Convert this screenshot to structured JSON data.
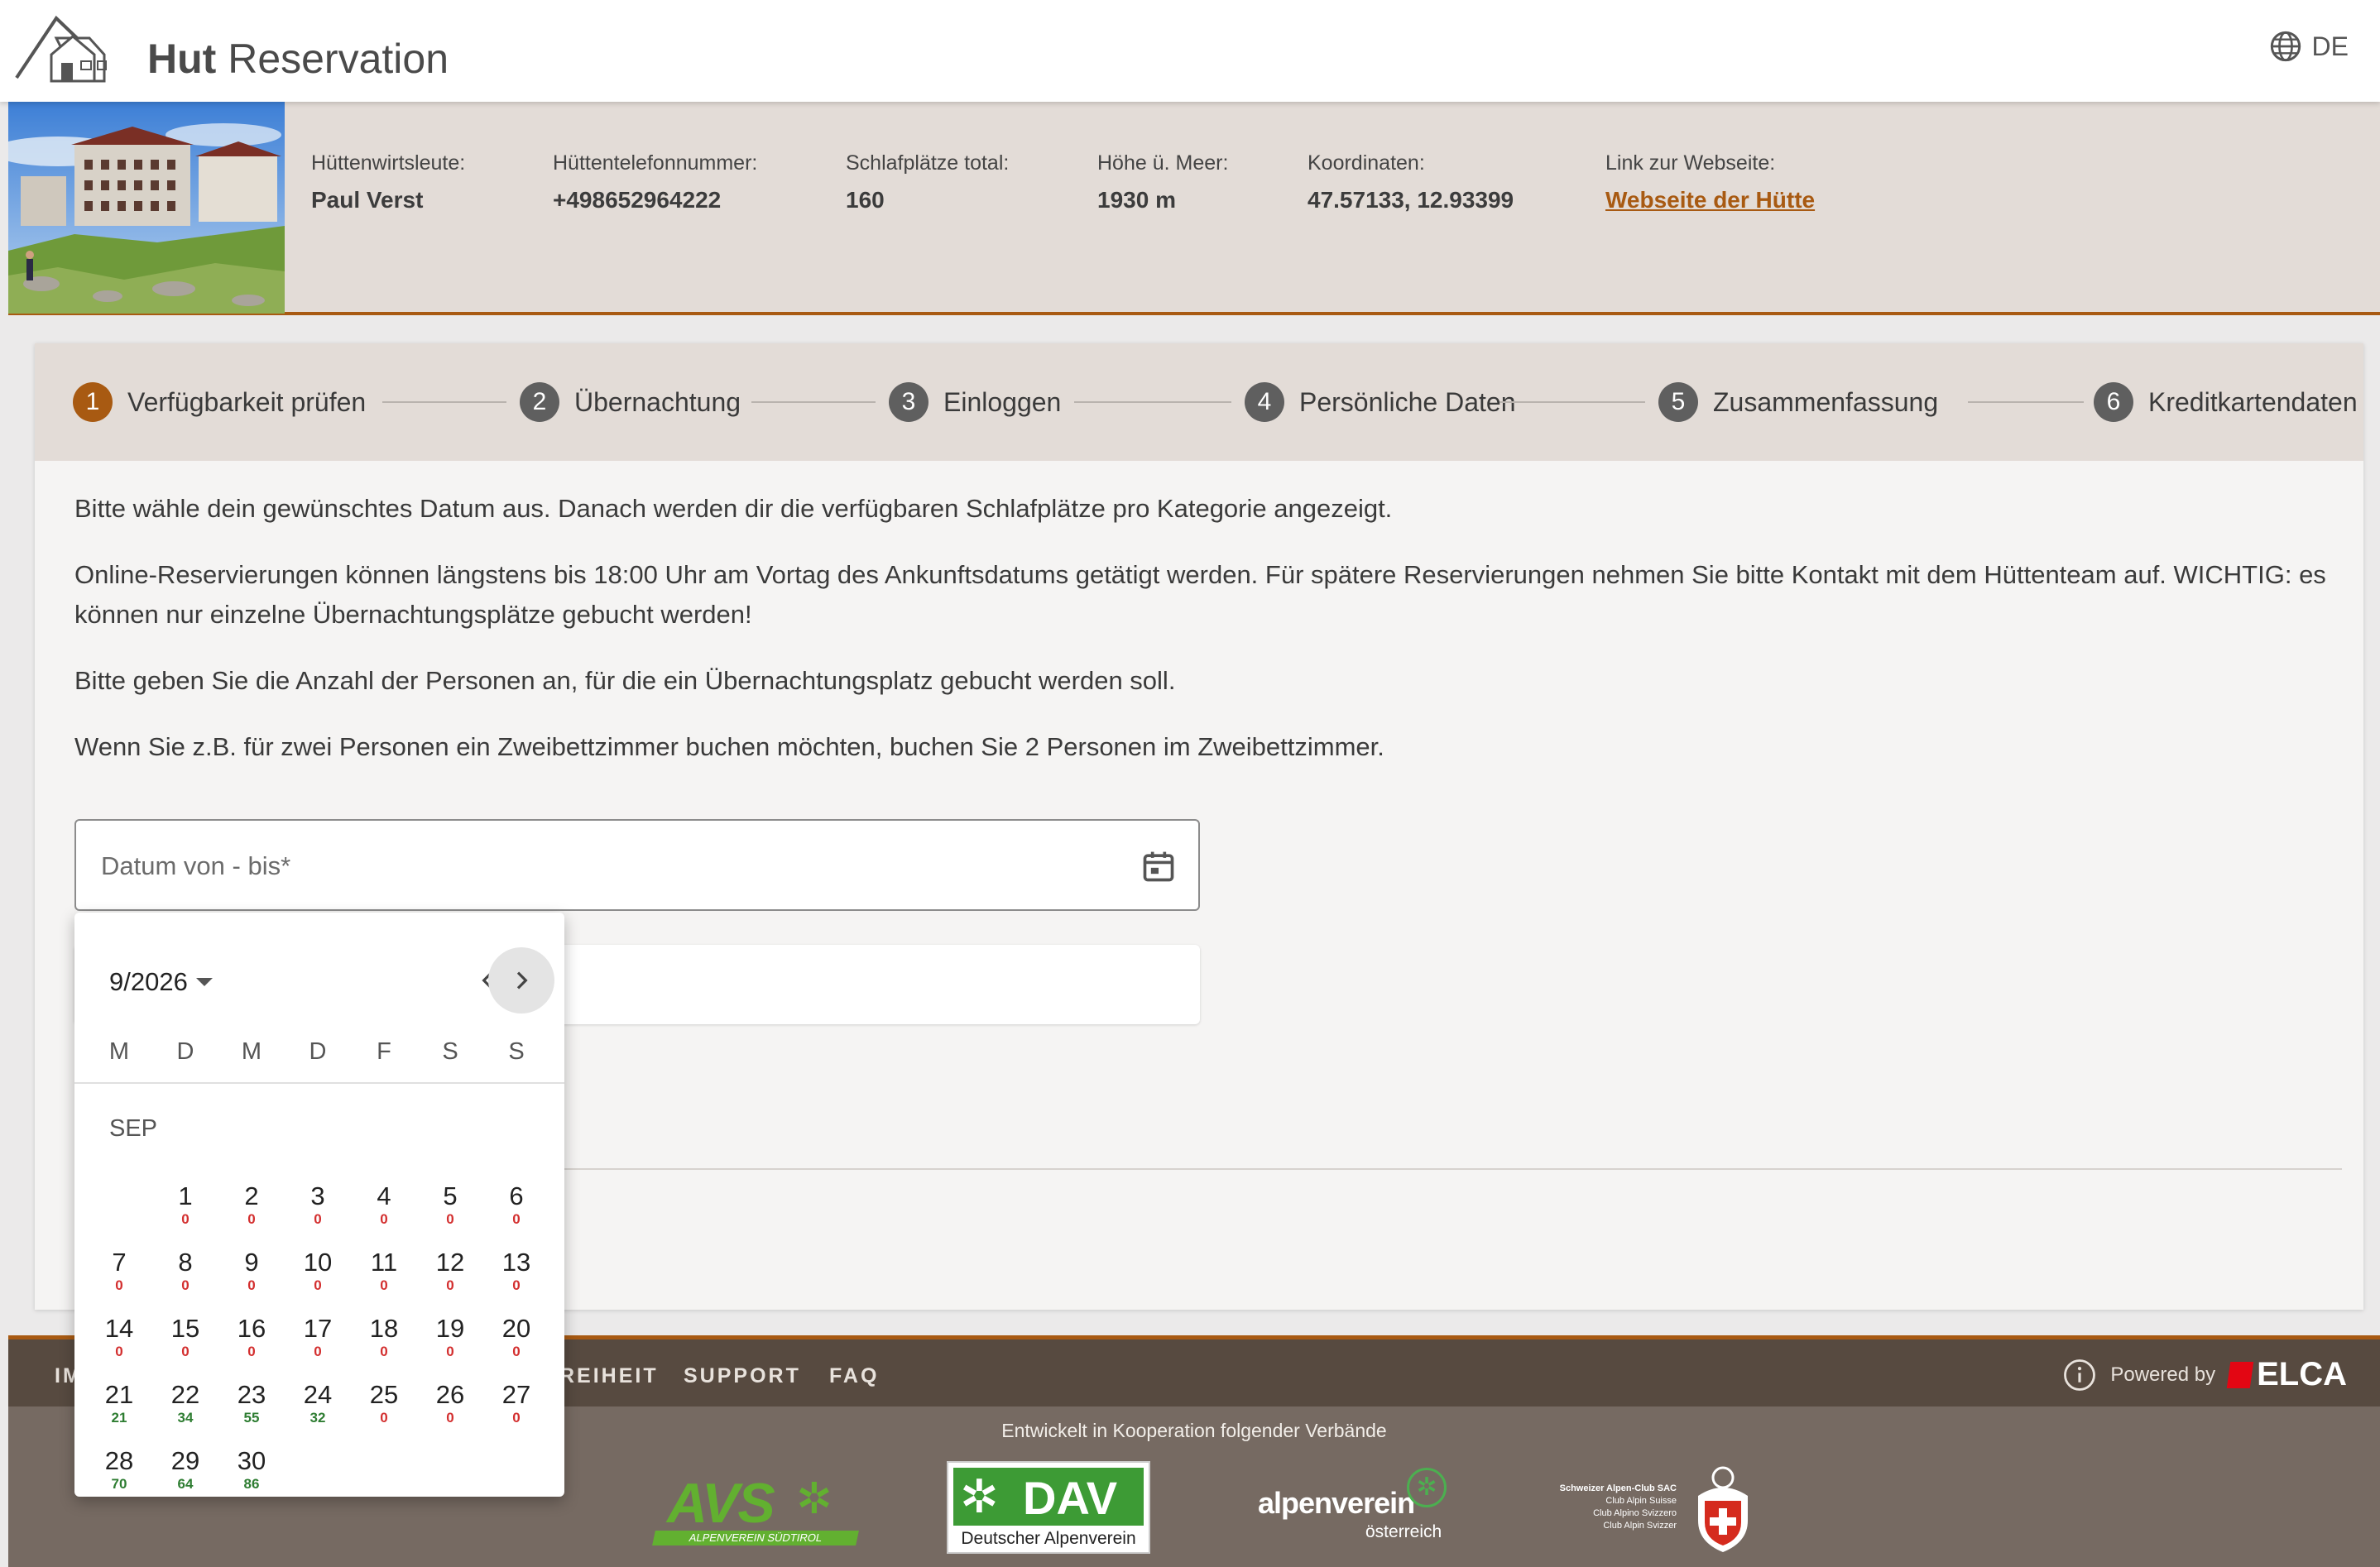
{
  "header": {
    "brand_bold": "Hut",
    "brand_rest": " Reservation",
    "lang": "DE"
  },
  "hut": {
    "fields": [
      {
        "label": "Hüttenwirtsleute:",
        "value": "Paul Verst"
      },
      {
        "label": "Hüttentelefonnummer:",
        "value": "+498652964222"
      },
      {
        "label": "Schlafplätze total:",
        "value": "160"
      },
      {
        "label": "Höhe ü. Meer:",
        "value": "1930 m"
      },
      {
        "label": "Koordinaten:",
        "value": "47.57133, 12.93399"
      },
      {
        "label": "Link zur Webseite:",
        "value": "Webseite der Hütte"
      }
    ]
  },
  "steps": [
    {
      "num": "1",
      "label": "Verfügbarkeit prüfen",
      "active": true
    },
    {
      "num": "2",
      "label": "Übernachtung"
    },
    {
      "num": "3",
      "label": "Einloggen"
    },
    {
      "num": "4",
      "label": "Persönliche Daten"
    },
    {
      "num": "5",
      "label": "Zusammenfassung"
    },
    {
      "num": "6",
      "label": "Kreditkartendaten"
    }
  ],
  "content": {
    "p1": "Bitte wähle dein gewünschtes Datum aus. Danach werden dir die verfügbaren Schlafplätze pro Kategorie angezeigt.",
    "p2": "Online-Reservierungen können längstens bis 18:00 Uhr am Vortag des Ankunftsdatums getätigt werden. Für spätere Reservierungen nehmen Sie bitte Kontakt mit dem Hüttenteam auf. WICHTIG: es können nur einzelne Übernachtungsplätze gebucht werden!",
    "p3": "Bitte geben Sie die Anzahl der Personen an, für die ein Übernachtungsplatz gebucht werden soll.",
    "p4": "Wenn Sie z.B. für zwei Personen ein Zweibettzimmer buchen möchten, buchen Sie 2 Personen im Zweibettzimmer.",
    "date_placeholder": "Datum von - bis*"
  },
  "calendar": {
    "period": "9/2026",
    "month_label": "SEP",
    "weekdays": [
      "M",
      "D",
      "M",
      "D",
      "F",
      "S",
      "S"
    ],
    "start_offset": 1,
    "days": [
      {
        "d": "1",
        "a": "0"
      },
      {
        "d": "2",
        "a": "0"
      },
      {
        "d": "3",
        "a": "0"
      },
      {
        "d": "4",
        "a": "0"
      },
      {
        "d": "5",
        "a": "0"
      },
      {
        "d": "6",
        "a": "0"
      },
      {
        "d": "7",
        "a": "0"
      },
      {
        "d": "8",
        "a": "0"
      },
      {
        "d": "9",
        "a": "0"
      },
      {
        "d": "10",
        "a": "0"
      },
      {
        "d": "11",
        "a": "0"
      },
      {
        "d": "12",
        "a": "0"
      },
      {
        "d": "13",
        "a": "0"
      },
      {
        "d": "14",
        "a": "0"
      },
      {
        "d": "15",
        "a": "0"
      },
      {
        "d": "16",
        "a": "0"
      },
      {
        "d": "17",
        "a": "0"
      },
      {
        "d": "18",
        "a": "0"
      },
      {
        "d": "19",
        "a": "0"
      },
      {
        "d": "20",
        "a": "0"
      },
      {
        "d": "21",
        "a": "21"
      },
      {
        "d": "22",
        "a": "34"
      },
      {
        "d": "23",
        "a": "55"
      },
      {
        "d": "24",
        "a": "32"
      },
      {
        "d": "25",
        "a": "0"
      },
      {
        "d": "26",
        "a": "0"
      },
      {
        "d": "27",
        "a": "0"
      },
      {
        "d": "28",
        "a": "70"
      },
      {
        "d": "29",
        "a": "64"
      },
      {
        "d": "30",
        "a": "86"
      }
    ],
    "colors": {
      "zero": "#d32f2f",
      "available": "#2e7d32"
    }
  },
  "footer": {
    "links": [
      "IM",
      "REIHEIT",
      "SUPPORT",
      "FAQ"
    ],
    "powered_by": "Powered by",
    "elca": "ELCA",
    "coop": "Entwickelt in Kooperation folgender Verbände",
    "avs": "AVS",
    "avs_sub": "ALPENVEREIN SÜDTIROL",
    "dav": "DAV",
    "dav_sub": "Deutscher Alpenverein",
    "oeav": "alpenverein",
    "oeav_sub": "österreich",
    "sac_lines": [
      "Schweizer Alpen-Club SAC",
      "Club Alpin Suisse",
      "Club Alpino Svizzero",
      "Club Alpin Svizzer"
    ]
  },
  "colors": {
    "accent": "#a85a12",
    "band": "#e3dcd7",
    "footer_dark": "#574a40",
    "footer_light": "#766a62"
  }
}
